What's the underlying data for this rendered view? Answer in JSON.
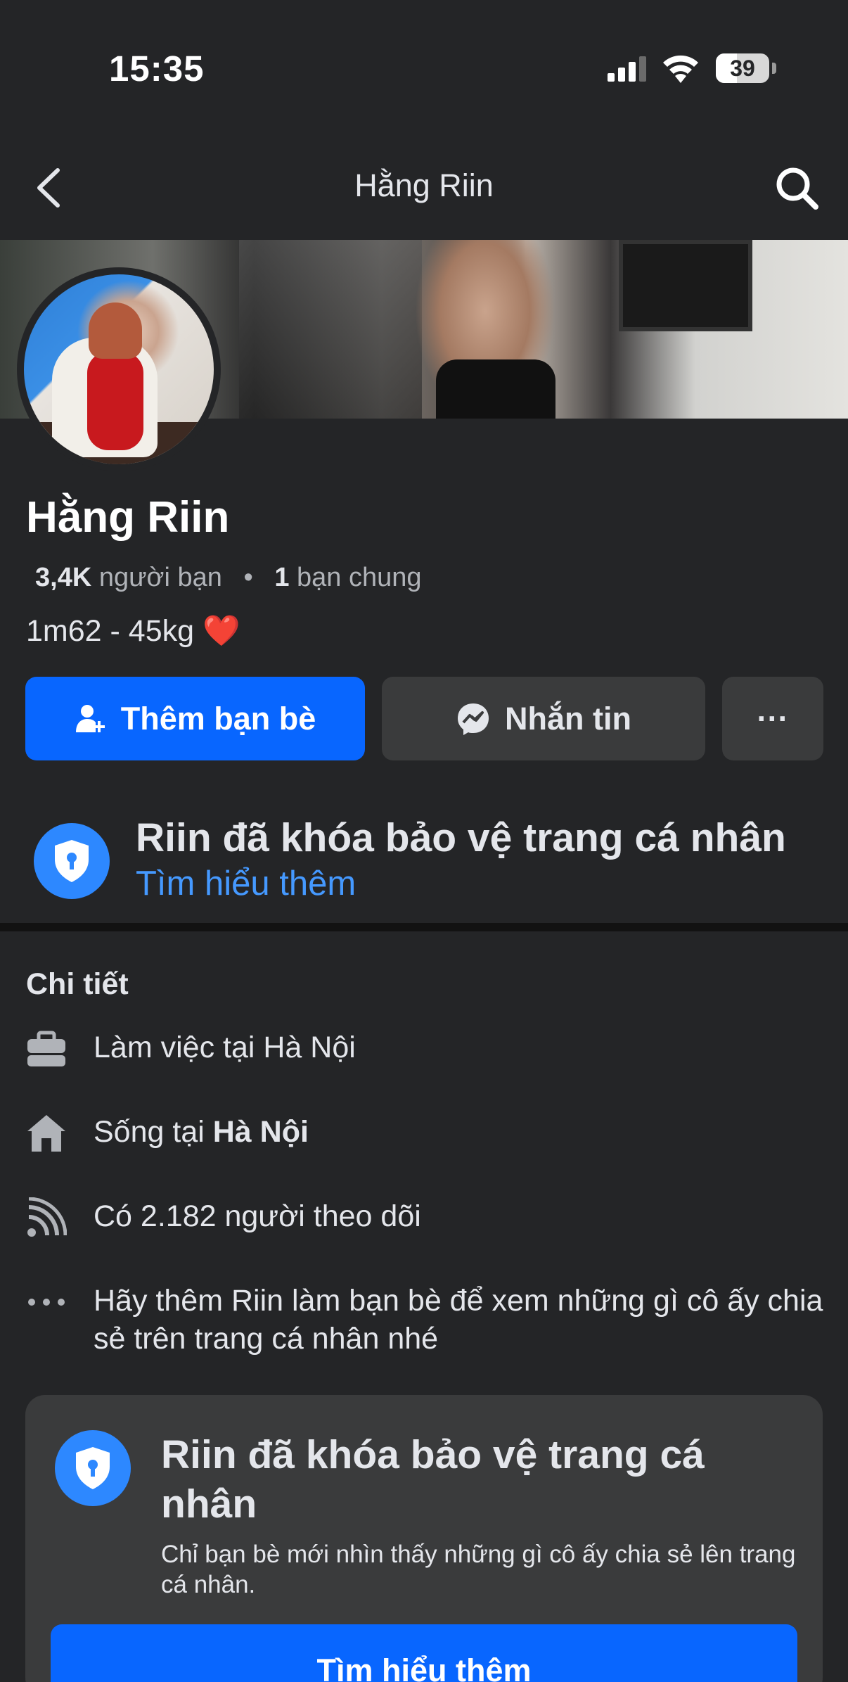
{
  "status_bar": {
    "time": "15:35",
    "battery": "39",
    "battery_level": 0.39
  },
  "nav": {
    "title": "Hằng Riin",
    "back_icon": "chevron-left-icon",
    "search_icon": "search-icon"
  },
  "profile": {
    "name": "Hằng Riin",
    "friends_count": "3,4K",
    "friends_label": "người bạn",
    "mutual_count": "1",
    "mutual_label": "bạn chung",
    "bio": "1m62 - 45kg",
    "bio_emoji": "❤️"
  },
  "actions": {
    "add_friend": "Thêm bạn bè",
    "message": "Nhắn tin",
    "more": "···"
  },
  "lock_banner": {
    "title": "Riin đã khóa bảo vệ trang cá nhân",
    "link": "Tìm hiểu thêm"
  },
  "details": {
    "title": "Chi tiết",
    "items": [
      {
        "icon": "briefcase-icon",
        "text": "Làm việc tại Hà Nội"
      },
      {
        "icon": "home-icon",
        "prefix": "Sống tại ",
        "bold": "Hà Nội"
      },
      {
        "icon": "rss-icon",
        "text": "Có 2.182 người theo dõi"
      },
      {
        "icon": "more-dots-icon",
        "text": "Hãy thêm Riin làm bạn bè để xem những gì cô ấy chia sẻ trên trang cá nhân nhé"
      }
    ]
  },
  "lock_card": {
    "title": "Riin đã khóa bảo vệ trang cá nhân",
    "description": "Chỉ bạn bè mới nhìn thấy những gì cô ấy chia sẻ lên trang cá nhân.",
    "button": "Tìm hiểu thêm"
  },
  "colors": {
    "accent": "#0866ff",
    "link": "#4599ff",
    "background": "#242527",
    "surface": "#3a3b3c"
  }
}
